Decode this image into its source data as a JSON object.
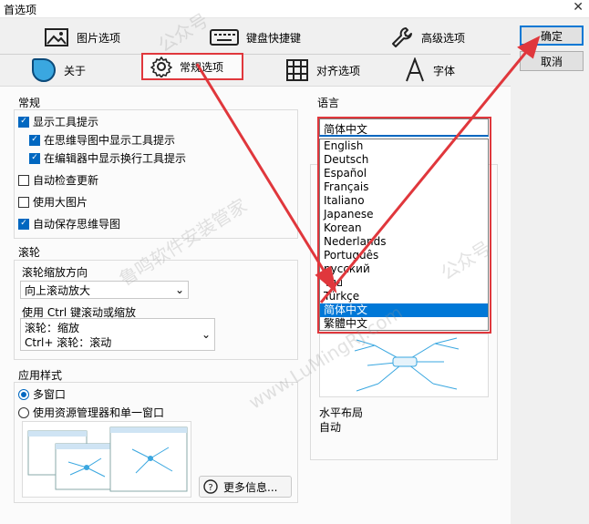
{
  "window": {
    "title": "首选项",
    "close_glyph": "✕"
  },
  "tabs": {
    "row1": [
      {
        "label": "图片选项",
        "icon": "image-icon"
      },
      {
        "label": "键盘快捷键",
        "icon": "keyboard-icon"
      },
      {
        "label": "高级选项",
        "icon": "wrench-icon"
      }
    ],
    "row2": [
      {
        "label": "关于",
        "icon": "app-logo-icon"
      },
      {
        "label": "常规选项",
        "icon": "gear-icon",
        "active": true
      },
      {
        "label": "对齐选项",
        "icon": "grid-icon"
      },
      {
        "label": "字体",
        "icon": "font-a-icon"
      }
    ]
  },
  "buttons": {
    "ok": "确定",
    "cancel": "取消"
  },
  "general": {
    "label": "常规",
    "show_tooltips": {
      "label": "显示工具提示",
      "checked": true
    },
    "show_in_mindmap": {
      "label": "在思维导图中显示工具提示",
      "checked": true
    },
    "show_in_editor": {
      "label": "在编辑器中显示换行工具提示",
      "checked": true
    },
    "auto_update": {
      "label": "自动检查更新",
      "checked": false
    },
    "large_images": {
      "label": "使用大图片",
      "checked": false
    },
    "autosave": {
      "label": "自动保存思维导图",
      "checked": true
    }
  },
  "wheel": {
    "label": "滚轮",
    "direction_label": "滚轮缩放方向",
    "direction_value": "向上滚动放大",
    "ctrl_label": "使用 Ctrl 键滚动或缩放",
    "ctrl_options": [
      "滚轮：缩放",
      "Ctrl+ 滚轮：滚动"
    ]
  },
  "app_style": {
    "label": "应用样式",
    "multi_window": {
      "label": "多窗口",
      "checked": true
    },
    "single_window": {
      "label": "使用资源管理器和单一窗口",
      "checked": false
    },
    "more_info": "更多信息..."
  },
  "language": {
    "label": "语言",
    "current": "简体中文",
    "options": [
      "English",
      "Deutsch",
      "Español",
      "Français",
      "Italiano",
      "Japanese",
      "Korean",
      "Nederlands",
      "Português",
      "русский",
      "ไทย",
      "Türkçe",
      "简体中文",
      "繁體中文"
    ],
    "selected_index": 12
  },
  "layout": {
    "name": "水平布局",
    "value": "自动"
  },
  "colors": {
    "accent": "#0067c0",
    "highlight": "#e0373c",
    "selection": "#0078d7"
  },
  "watermarks": [
    "公众号",
    "鲁鸣软件安装管家",
    "www.LuMingRJ.com"
  ]
}
